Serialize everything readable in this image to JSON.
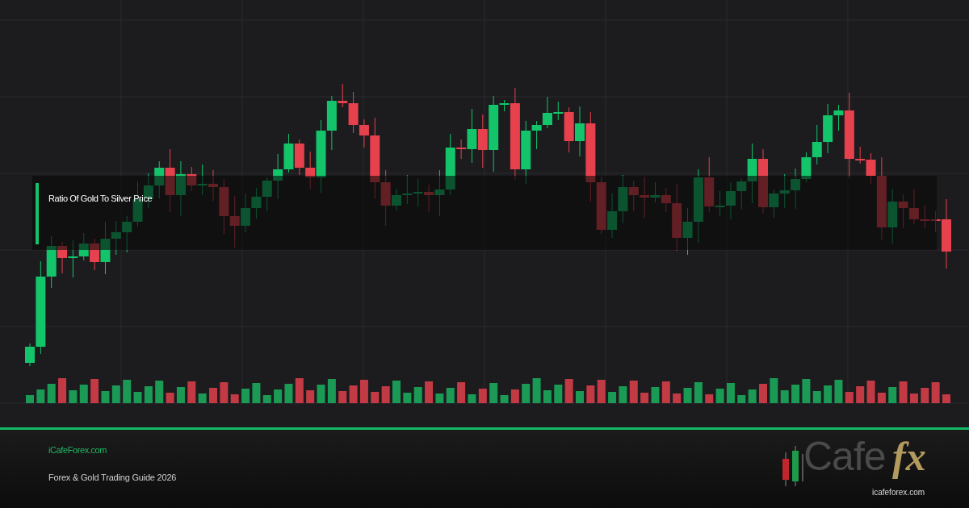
{
  "chart": {
    "title": "Ratio Of Gold To Silver Price"
  },
  "footer": {
    "site": "iCafeForex.com",
    "caption": "Forex & Gold Trading Guide 2026"
  },
  "logo": {
    "wordmark": "Cafe",
    "emblem": "fx",
    "url": "icafeforex.com"
  }
}
